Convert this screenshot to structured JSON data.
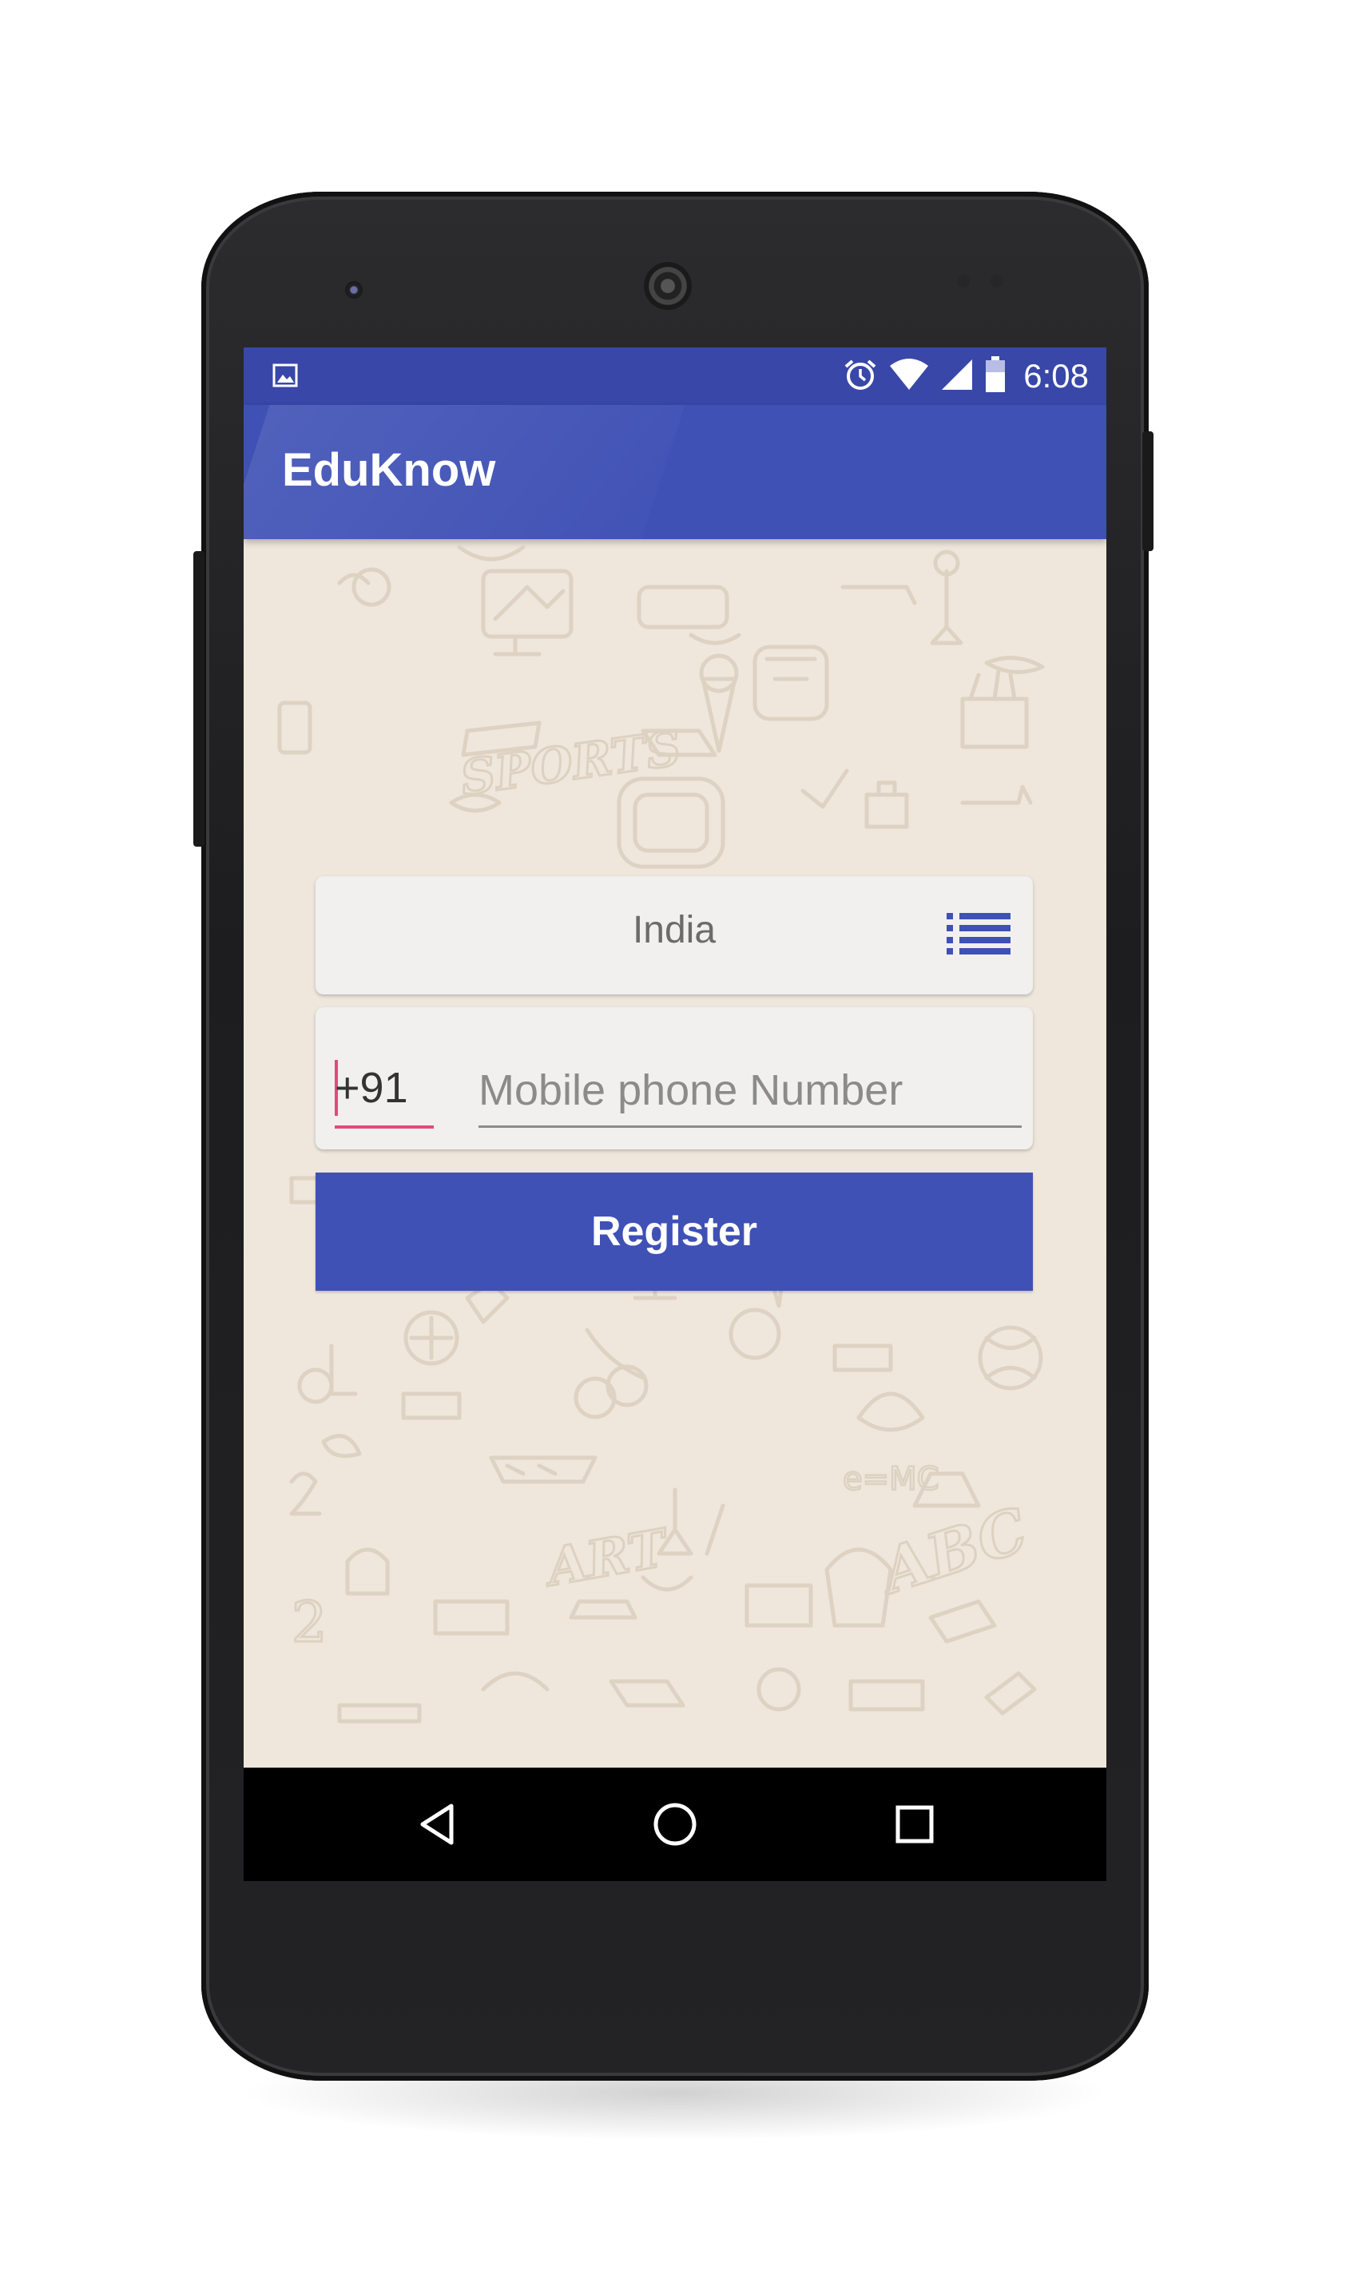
{
  "status_bar": {
    "time": "6:08",
    "icons": [
      "image-notification-icon",
      "alarm-icon",
      "wifi-icon",
      "cell-signal-icon",
      "battery-icon"
    ],
    "background": "#3847a8"
  },
  "app_bar": {
    "title": "EduKnow",
    "background": "#3f51b5"
  },
  "country_selector": {
    "selected": "India",
    "icon": "list-icon",
    "icon_color": "#3f51b5"
  },
  "phone_form": {
    "country_code": "+91",
    "phone_value": "",
    "phone_placeholder": "Mobile phone Number",
    "accent": "#e24a7d"
  },
  "register_button": {
    "label": "Register",
    "background": "#3f51b5"
  },
  "nav_bar": {
    "icons": [
      "back-icon",
      "home-icon",
      "recents-icon"
    ]
  }
}
